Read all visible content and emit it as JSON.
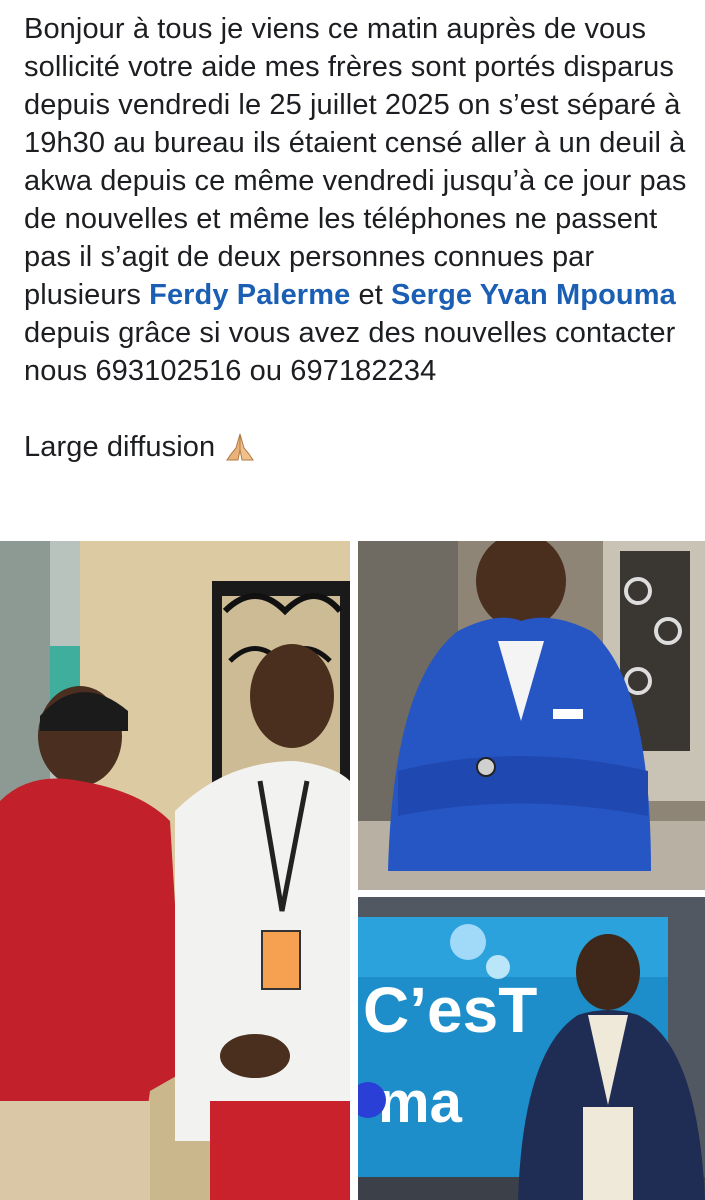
{
  "post": {
    "text_part1": "Bonjour à tous je viens ce matin auprès de vous sollicité votre aide mes frères sont portés disparus depuis vendredi le 25 juillet 2025 on s’est séparé à 19h30 au bureau ils étaient censé aller à un deuil à akwa depuis ce même vendredi jusqu’à ce jour pas de nouvelles et même les téléphones ne passent pas il s’agit de deux personnes connues par plusieurs ",
    "mention1": "Ferdy Palerme",
    "text_part2": " et ",
    "mention2": "Serge Yvan Mpouma",
    "text_part3": " depuis grâce si vous avez des nouvelles contacter nous 693102516 ou 697182234",
    "diffusion": "Large diffusion",
    "diffusion_icon": "praying-hands-icon",
    "mention_color": "#1a5fb4"
  },
  "photos": {
    "left": {
      "subject": "two-men-standing-photo"
    },
    "top_right": {
      "subject": "man-in-blue-blazer-photo"
    },
    "bottom_right": {
      "subject": "man-in-tv-studio-photo",
      "screen_text_1": "C’esT",
      "screen_text_2": "ma"
    }
  }
}
